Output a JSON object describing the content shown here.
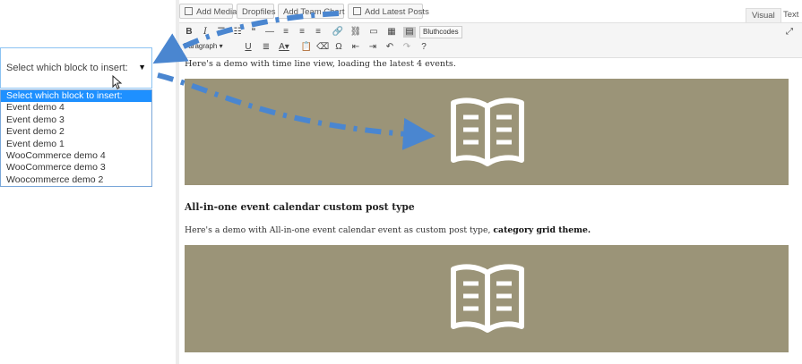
{
  "select": {
    "closed_label": "Select which block to insert:",
    "options": [
      "Select which block to insert:",
      "Event demo 4",
      "Event demo 3",
      "Event demo 2",
      "Event demo 1",
      "WooCommerce demo 4",
      "WooCommerce demo 3",
      "Woocommerce demo 2"
    ],
    "selected_index": 0
  },
  "media_buttons": {
    "add_media": "Add Media",
    "dropfiles": "Dropfiles",
    "add_team_chart": "Add Team Chart",
    "add_latest_posts": "Add Latest Posts"
  },
  "mode_tabs": {
    "visual": "Visual",
    "text": "Text"
  },
  "toolbar": {
    "paragraph": "Paragraph",
    "bluthcodes": "Bluthcodes"
  },
  "content": {
    "intro": "Here's a demo with time line view, loading the latest 4 events.",
    "heading": "All-in-one event calendar custom post type",
    "desc_plain": "Here's a demo with All-in-one event calendar event as custom post type, ",
    "desc_bold": "category grid theme."
  },
  "colors": {
    "placeholder_bg": "#9b9478",
    "arrow": "#4a86d0",
    "selected_option": "#1e90ff"
  }
}
